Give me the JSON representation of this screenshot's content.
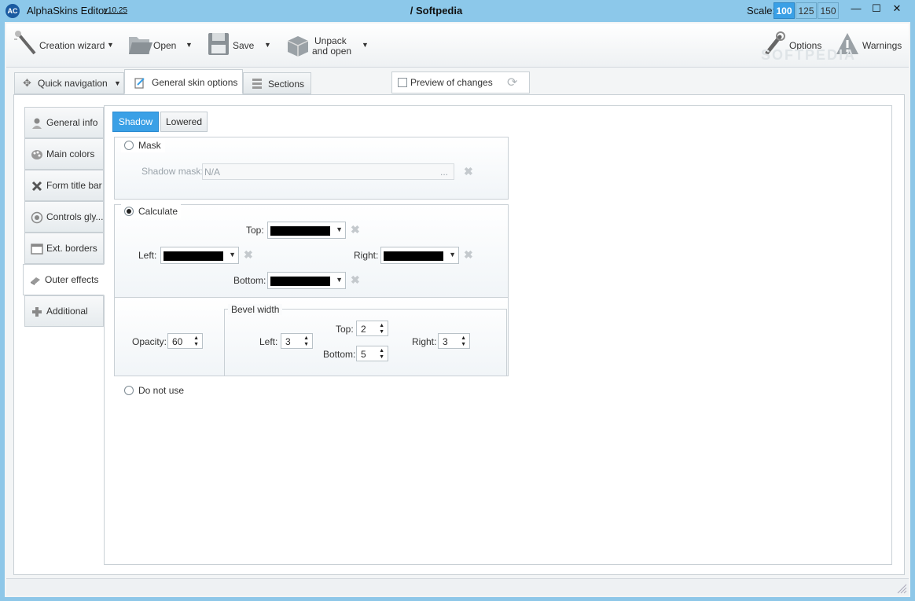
{
  "titlebar": {
    "app_name": "AlphaSkins Editor",
    "version": "v10.25",
    "logo": "AC",
    "window_title": "/ Softpedia",
    "scale_label": "Scale:",
    "scale_options": [
      "100",
      "125",
      "150"
    ],
    "scale_selected": "100",
    "minimize": "—",
    "maximize": "☐",
    "close": "✕"
  },
  "toolbar": {
    "creation_wizard": "Creation wizard",
    "open": "Open",
    "save": "Save",
    "unpack_line1": "Unpack",
    "unpack_line2": "and open",
    "options": "Options",
    "warnings": "Warnings",
    "watermark": "SOFTPEDIA"
  },
  "tabs": {
    "quick_navigation": "Quick navigation",
    "general_skin_options": "General  skin options",
    "sections": "Sections",
    "preview_of_changes": "Preview of changes"
  },
  "side_tabs": [
    {
      "label": "General info",
      "icon": "person-icon"
    },
    {
      "label": "Main colors",
      "icon": "palette-icon"
    },
    {
      "label": "Form title bar",
      "icon": "cross-icon"
    },
    {
      "label": "Controls gly...",
      "icon": "glyph-icon"
    },
    {
      "label": "Ext. borders",
      "icon": "border-icon"
    },
    {
      "label": "Outer effects",
      "icon": "eraser-icon"
    },
    {
      "label": "Additional",
      "icon": "plus-icon"
    }
  ],
  "active_side_tab": "Outer effects",
  "sub_tabs": {
    "shadow": "Shadow",
    "lowered": "Lowered",
    "active": "Shadow"
  },
  "mask": {
    "label": "Mask",
    "shadow_mask_label": "Shadow mask:",
    "shadow_mask_value": "N/A",
    "browse": "..."
  },
  "calculate": {
    "label": "Calculate",
    "selected": true,
    "top_label": "Top:",
    "left_label": "Left:",
    "right_label": "Right:",
    "bottom_label": "Bottom:",
    "color": "#000000"
  },
  "opacity": {
    "label": "Opacity:",
    "value": "60"
  },
  "bevel": {
    "title": "Bevel width",
    "left_label": "Left:",
    "left_value": "3",
    "top_label": "Top:",
    "top_value": "2",
    "bottom_label": "Bottom:",
    "bottom_value": "5",
    "right_label": "Right:",
    "right_value": "3"
  },
  "do_not_use": "Do not use",
  "colors": {
    "accent": "#3aa0e6",
    "titlebar": "#8cc8ea"
  }
}
